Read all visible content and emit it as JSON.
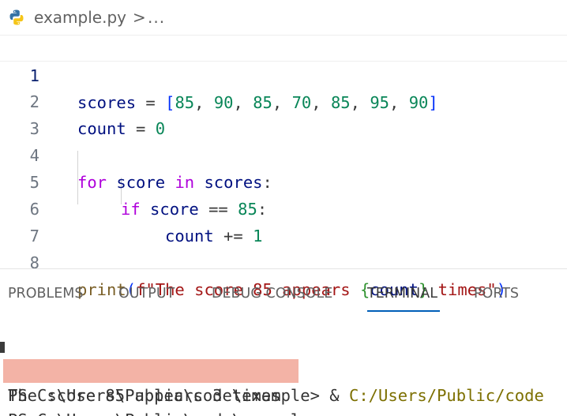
{
  "breadcrumb": {
    "file": "example.py",
    "separator": ">",
    "more": "..."
  },
  "editor": {
    "lines": [
      {
        "num": "1"
      },
      {
        "num": "2"
      },
      {
        "num": "3"
      },
      {
        "num": "4"
      },
      {
        "num": "5"
      },
      {
        "num": "6"
      },
      {
        "num": "7"
      },
      {
        "num": "8"
      }
    ],
    "code": {
      "l1_var": "scores",
      "l1_eq": " = ",
      "l1_open": "[",
      "l1_v1": "85",
      "l1_v2": "90",
      "l1_v3": "85",
      "l1_v4": "70",
      "l1_v5": "85",
      "l1_v6": "95",
      "l1_v7": "90",
      "l1_sep": ", ",
      "l1_close": "]",
      "l2_var": "count",
      "l2_eq": " = ",
      "l2_val": "0",
      "l4_for": "for",
      "l4_score": "score",
      "l4_in": "in",
      "l4_scores": "scores",
      "l4_colon": ":",
      "l5_if": "if",
      "l5_score": "score",
      "l5_op": " == ",
      "l5_val": "85",
      "l5_colon": ":",
      "l6_count": "count",
      "l6_op": " += ",
      "l6_val": "1",
      "l8_print": "print",
      "l8_open": "(",
      "l8_str1": "f\"The score 85 appears ",
      "l8_brace_open": "{",
      "l8_count": "count",
      "l8_brace_close": "}",
      "l8_str2": " times\"",
      "l8_close": ")"
    }
  },
  "panel": {
    "tabs": [
      "PROBLEMS",
      "OUTPUT",
      "DEBUG CONSOLE",
      "TERMINAL",
      "PORTS"
    ]
  },
  "terminal": {
    "line1_prompt": "PS C:\\Users\\Public\\code\\example>",
    "line1_amp": " & ",
    "line1_path": "C:/Users/Public/code",
    "line2_output": "The score 85 appears 3 times",
    "line3_prompt": "PS C:\\Users\\Public\\code\\example>"
  }
}
